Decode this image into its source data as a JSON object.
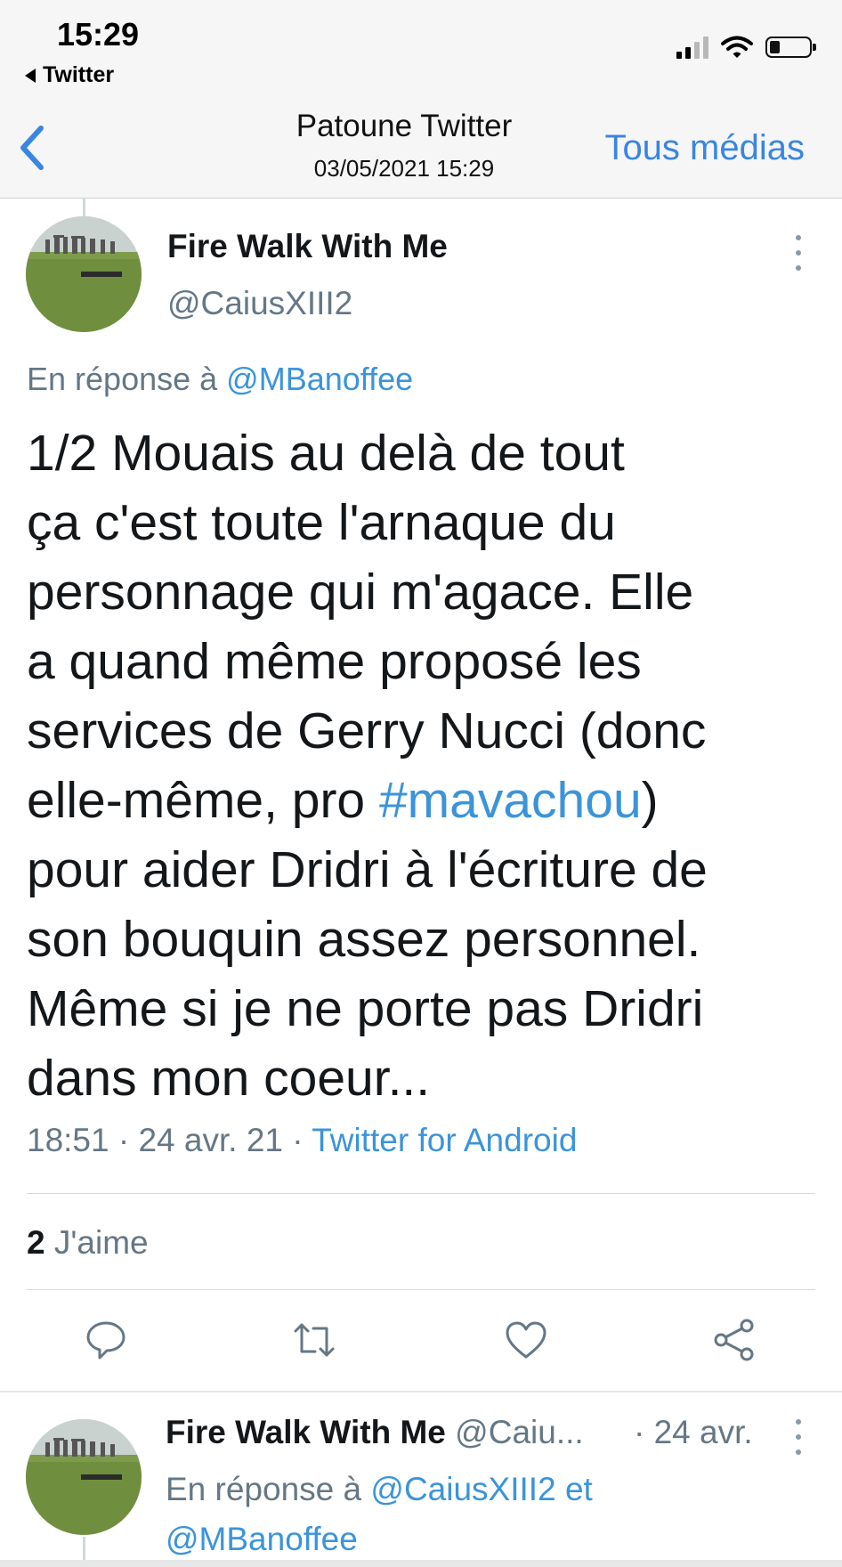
{
  "status_bar": {
    "time": "15:29",
    "back_app": "Twitter"
  },
  "nav": {
    "title": "Patoune Twitter",
    "subtitle": "03/05/2021 15:29",
    "right_action": "Tous médias"
  },
  "tweet": {
    "author_name": "Fire Walk With Me",
    "author_handle": "@CaiusXIII2",
    "reply_prefix": "En réponse à",
    "reply_to": "@MBanoffee",
    "text_before_tag": "1/2 Mouais au delà de tout\nça c'est toute l'arnaque du\npersonnage qui m'agace. Elle\na quand même proposé les\nservices de Gerry Nucci (donc\nelle-même, pro ",
    "hashtag": "#mavachou",
    "text_after_tag": ")\npour aider Dridri à l'écriture de\nson bouquin assez personnel.\nMême si je ne porte pas Dridri\ndans mon coeur...",
    "time": "18:51",
    "date": "24 avr. 21",
    "source": "Twitter for Android",
    "separator": " · ",
    "likes_count": "2",
    "likes_label": "J'aime"
  },
  "reply_tweet": {
    "author_name": "Fire Walk With Me",
    "author_handle": "@Caiu...",
    "date": "· 24 avr.",
    "reply_prefix": "En réponse à",
    "reply_to_1": "@CaiusXIII2",
    "conjunction": "et",
    "reply_to_2": "@MBanoffee"
  },
  "icons": [
    "back-chevron-icon",
    "signal-icon",
    "wifi-icon",
    "battery-icon",
    "more-icon",
    "reply-icon",
    "retweet-icon",
    "like-icon",
    "share-icon"
  ],
  "colors": {
    "link": "#3b94d9",
    "ios_blue": "#3a86e0",
    "secondary_text": "#657786"
  }
}
